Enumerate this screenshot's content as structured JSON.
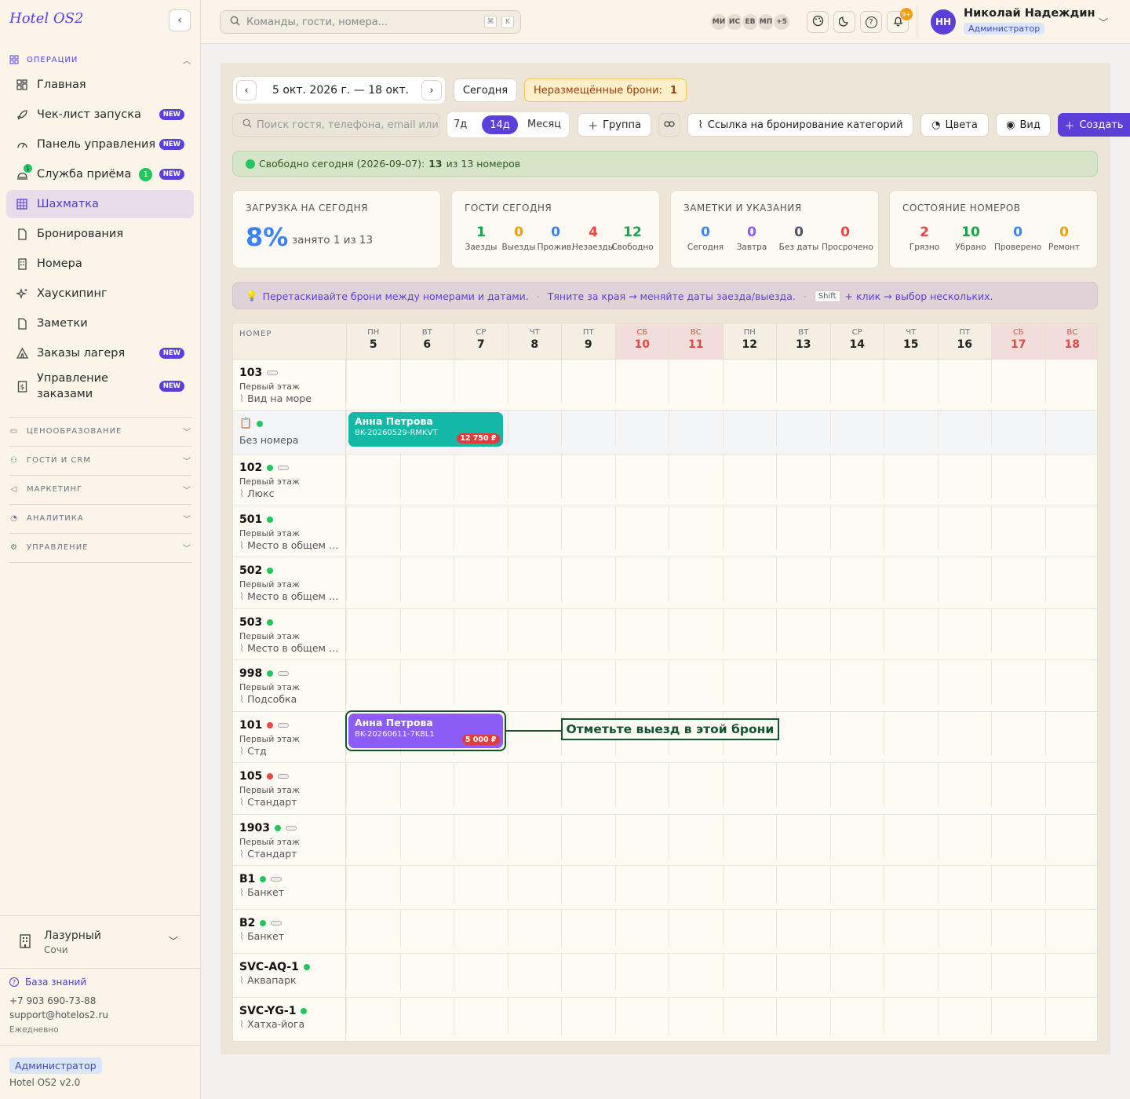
{
  "sidebar": {
    "brand": "Hotel OS2",
    "collapse_icon": "‹",
    "operations_label": "ОПЕРАЦИИ",
    "items": [
      {
        "label": "Главная",
        "icon": "dashboard-icon"
      },
      {
        "label": "Чек-лист запуска",
        "icon": "rocket-icon",
        "badge": "NEW"
      },
      {
        "label": "Панель управления",
        "icon": "gauge-icon",
        "badge": "NEW"
      },
      {
        "label": "Служба приёма",
        "icon": "bell-desk-icon",
        "badge": "NEW",
        "count": "1",
        "icon_count": "1"
      },
      {
        "label": "Шахматка",
        "icon": "grid-icon",
        "active": true
      },
      {
        "label": "Бронирования",
        "icon": "document-icon"
      },
      {
        "label": "Номера",
        "icon": "building-icon"
      },
      {
        "label": "Хаускипинг",
        "icon": "sparkle-icon"
      },
      {
        "label": "Заметки",
        "icon": "note-icon"
      },
      {
        "label": "Заказы лагеря",
        "icon": "tent-icon",
        "badge": "NEW"
      },
      {
        "label": "Управление заказами",
        "label_line1": "Управление",
        "label_line2": "заказами",
        "icon": "dollar-doc-icon",
        "badge": "NEW"
      }
    ],
    "sections": [
      "ЦЕНООБРАЗОВАНИЕ",
      "ГОСТИ И CRM",
      "МАРКЕТИНГ",
      "АНАЛИТИКА",
      "УПРАВЛЕНИЕ"
    ],
    "hotel_name": "Лазурный",
    "hotel_city": "Сочи",
    "knowledge_base": "База знаний",
    "phone": "+7 903 690-73-88",
    "email": "support@hotelos2.ru",
    "schedule": "Ежедневно",
    "role": "Администратор",
    "version": "Hotel OS2 v2.0"
  },
  "topbar": {
    "search_placeholder": "Команды, гости, номера...",
    "kbd1": "⌘",
    "kbd2": "K",
    "avatars": [
      "МИ",
      "ИС",
      "ЕВ",
      "МП",
      "+5"
    ],
    "notif_count": "9+",
    "user_initials": "НН",
    "user_name": "Николай Надеждин",
    "user_role": "Администратор"
  },
  "toolbar": {
    "date_range": "5 окт. 2026 г. — 18 окт.",
    "today": "Сегодня",
    "unplaced_label": "Неразмещённые брони:",
    "unplaced_count": "1",
    "guest_search_placeholder": "Поиск гостя, телефона, email или",
    "view_7": "7д",
    "view_14": "14д",
    "view_month": "Месяц",
    "group": "Группа",
    "booking_link": "Ссылка на бронирование категорий",
    "colors": "Цвета",
    "view": "Вид",
    "create": "Создать"
  },
  "free_today": {
    "prefix": "Свободно сегодня (2026-09-07):",
    "count": "13",
    "suffix": "из 13 номеров"
  },
  "stats": {
    "load": {
      "title": "ЗАГРУЗКА НА СЕГОДНЯ",
      "value": "8%",
      "text": "занято 1 из 13"
    },
    "guests": {
      "title": "ГОСТИ СЕГОДНЯ",
      "cells": [
        {
          "v": "1",
          "l": "Заезды",
          "c": "#16a34a"
        },
        {
          "v": "0",
          "l": "Выезды",
          "c": "#f59e0b"
        },
        {
          "v": "0",
          "l": "Прожив.",
          "c": "#3b82f6"
        },
        {
          "v": "4",
          "l": "Незаезды",
          "c": "#ef4444"
        },
        {
          "v": "12",
          "l": "Свободно",
          "c": "#16a34a"
        }
      ]
    },
    "notes": {
      "title": "ЗАМЕТКИ И УКАЗАНИЯ",
      "cells": [
        {
          "v": "0",
          "l": "Сегодня",
          "c": "#3b82f6"
        },
        {
          "v": "0",
          "l": "Завтра",
          "c": "#8b5cf6"
        },
        {
          "v": "0",
          "l": "Без даты",
          "c": "#4b5563"
        },
        {
          "v": "0",
          "l": "Просрочено",
          "c": "#ef4444"
        }
      ]
    },
    "rooms": {
      "title": "СОСТОЯНИЕ НОМЕРОВ",
      "cells": [
        {
          "v": "2",
          "l": "Грязно",
          "c": "#ef4444"
        },
        {
          "v": "10",
          "l": "Убрано",
          "c": "#16a34a"
        },
        {
          "v": "0",
          "l": "Проверено",
          "c": "#3b82f6"
        },
        {
          "v": "0",
          "l": "Ремонт",
          "c": "#f59e0b"
        }
      ]
    }
  },
  "hint": {
    "drag": "Перетаскивайте брони между номерами и датами.",
    "resize": "Тяните за края → меняйте даты заезда/выезда.",
    "key": "Shift",
    "multi": "+ клик → выбор нескольких."
  },
  "grid": {
    "room_header": "НОМЕР",
    "days": [
      {
        "w": "ПН",
        "d": "5"
      },
      {
        "w": "ВТ",
        "d": "6"
      },
      {
        "w": "СР",
        "d": "7"
      },
      {
        "w": "ЧТ",
        "d": "8"
      },
      {
        "w": "ПТ",
        "d": "9"
      },
      {
        "w": "СБ",
        "d": "10",
        "we": true
      },
      {
        "w": "ВС",
        "d": "11",
        "we": true
      },
      {
        "w": "ПН",
        "d": "12"
      },
      {
        "w": "ВТ",
        "d": "13"
      },
      {
        "w": "СР",
        "d": "14"
      },
      {
        "w": "ЧТ",
        "d": "15"
      },
      {
        "w": "ПТ",
        "d": "16"
      },
      {
        "w": "СБ",
        "d": "17",
        "we": true
      },
      {
        "w": "ВС",
        "d": "18",
        "we": true
      }
    ],
    "rows": [
      {
        "num": "103",
        "floor": "Первый этаж",
        "cat": "Вид на море",
        "dot": "",
        "pill": true
      },
      {
        "num": "",
        "floor": "",
        "cat": "Без номера",
        "dot": "#22c55e",
        "pill": false,
        "unassigned": true
      },
      {
        "num": "102",
        "floor": "Первый этаж",
        "cat": "Люкс",
        "dot": "#22c55e",
        "pill": true
      },
      {
        "num": "501",
        "floor": "Первый этаж",
        "cat": "Место в общем номере",
        "dot": "#22c55e",
        "pill": false
      },
      {
        "num": "502",
        "floor": "Первый этаж",
        "cat": "Место в общем номере",
        "dot": "#22c55e",
        "pill": false
      },
      {
        "num": "503",
        "floor": "Первый этаж",
        "cat": "Место в общем номере",
        "dot": "#22c55e",
        "pill": false
      },
      {
        "num": "998",
        "floor": "Первый этаж",
        "cat": "Подсобка",
        "dot": "#22c55e",
        "pill": true
      },
      {
        "num": "101",
        "floor": "Первый этаж",
        "cat": "Стд",
        "dot": "#ef4444",
        "pill": true
      },
      {
        "num": "105",
        "floor": "Первый этаж",
        "cat": "Стандарт",
        "dot": "#ef4444",
        "pill": true
      },
      {
        "num": "1903",
        "floor": "Первый этаж",
        "cat": "Стандарт",
        "dot": "#22c55e",
        "pill": true
      },
      {
        "num": "B1",
        "floor": "",
        "cat": "Банкет",
        "dot": "#22c55e",
        "pill": true
      },
      {
        "num": "B2",
        "floor": "",
        "cat": "Банкет",
        "dot": "#22c55e",
        "pill": true
      },
      {
        "num": "SVC-AQ-1",
        "floor": "",
        "cat": "Аквапарк",
        "dot": "#22c55e",
        "pill": false
      },
      {
        "num": "SVC-YG-1",
        "floor": "",
        "cat": "Хатха-йога",
        "dot": "#22c55e",
        "pill": false
      }
    ],
    "bookings": [
      {
        "row": 1,
        "start": 0,
        "nights": 3,
        "name": "Анна Петрова",
        "code": "BK-20260529-RMKVT",
        "price": "12 750 ₽",
        "color": "#14b8a6"
      },
      {
        "row": 7,
        "start": 0,
        "nights": 3,
        "name": "Анна Петрова",
        "code": "BK-20260611-7K8L1",
        "price": "5 000 ₽",
        "color": "#8b5cf6",
        "highlight": true
      }
    ],
    "callout": "Отметьте выезд в этой брони"
  }
}
